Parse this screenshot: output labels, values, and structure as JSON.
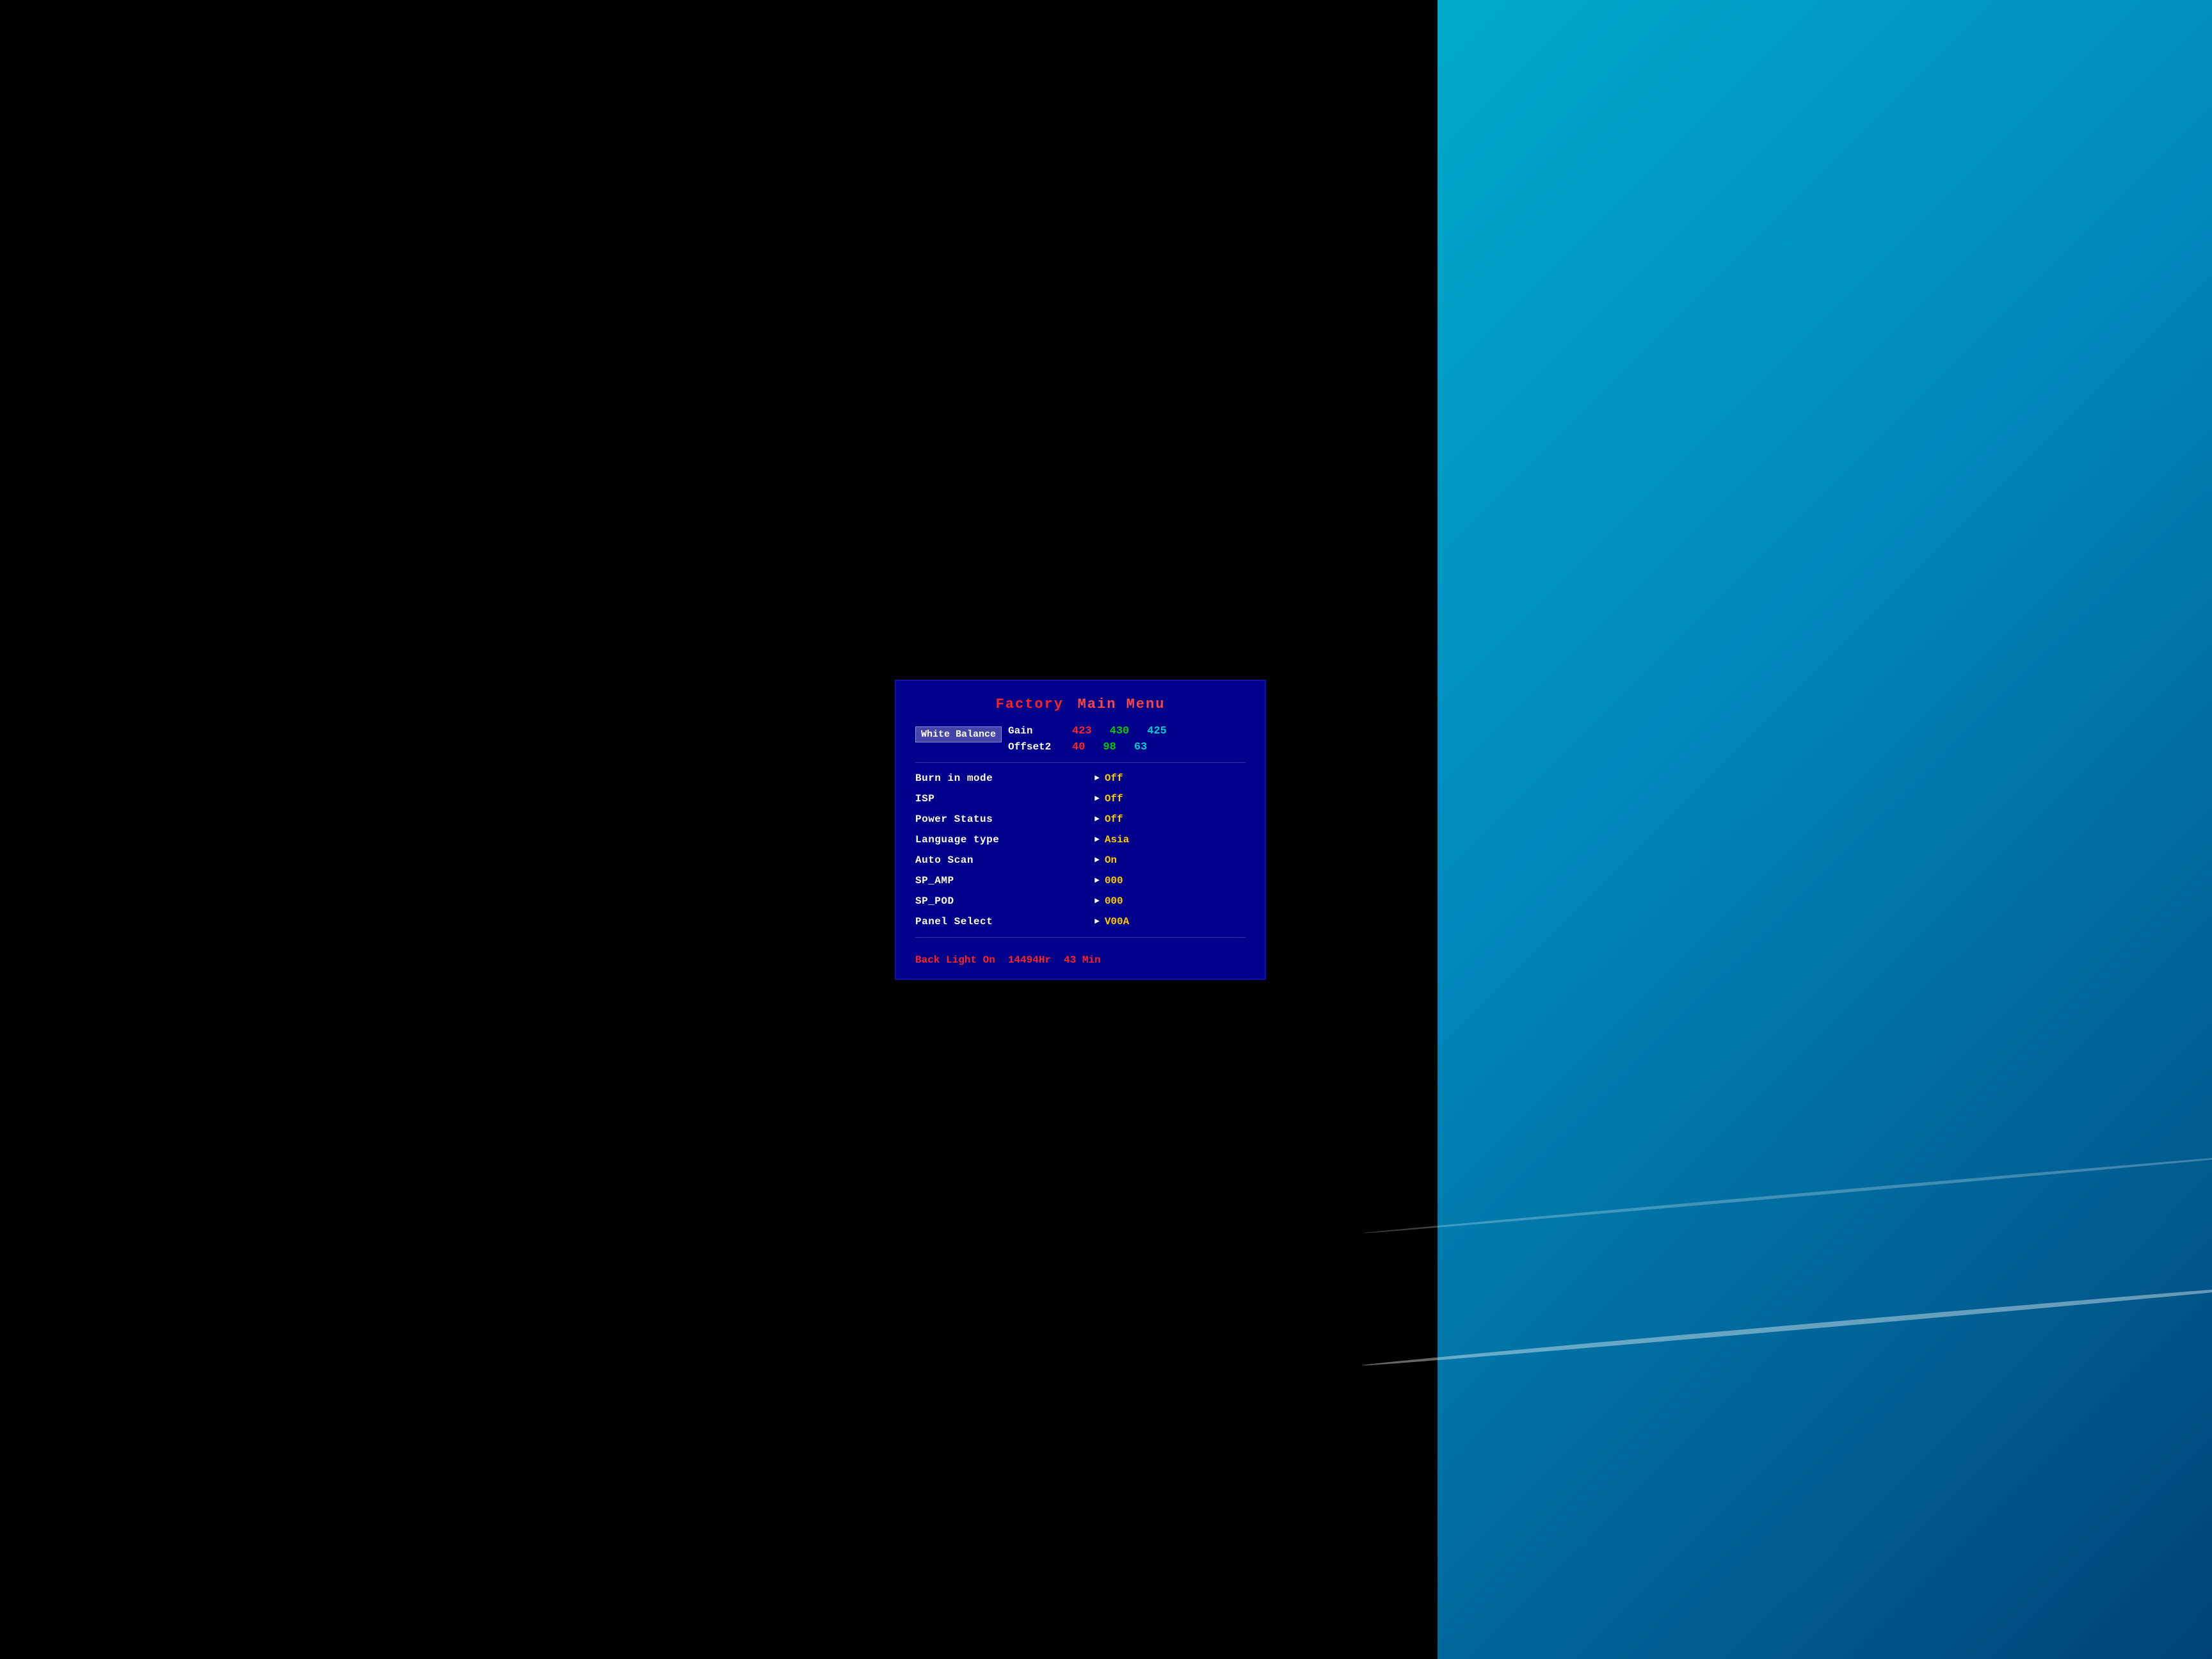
{
  "title": {
    "factory": "Factory",
    "main_menu": "Main Menu"
  },
  "white_balance": {
    "label": "White Balance",
    "gain": {
      "label": "Gain",
      "red": "423",
      "green": "430",
      "cyan": "425"
    },
    "offset2": {
      "label": "Offset2",
      "red": "40",
      "green": "98",
      "cyan": "63"
    }
  },
  "menu_items": [
    {
      "label": "Burn in mode",
      "value": "Off"
    },
    {
      "label": "ISP",
      "value": "Off"
    },
    {
      "label": "Power Status",
      "value": "Off"
    },
    {
      "label": "Language type",
      "value": "Asia"
    },
    {
      "label": "Auto Scan",
      "value": "On"
    },
    {
      "label": "SP_AMP",
      "value": "000"
    },
    {
      "label": "SP_POD",
      "value": "000"
    },
    {
      "label": "Panel Select",
      "value": "V00A"
    }
  ],
  "footer": {
    "label": "Back Light On",
    "hours": "14494Hr",
    "minutes": "43 Min"
  }
}
